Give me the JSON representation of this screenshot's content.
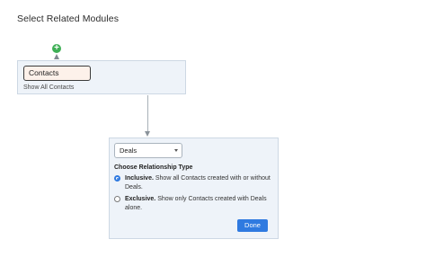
{
  "page": {
    "title": "Select Related Modules"
  },
  "add_node": {
    "symbol": "+",
    "icon": "plus-circle-icon",
    "color": "#3eaf55"
  },
  "module_card": {
    "chip_label": "Contacts",
    "subtext": "Show All Contacts"
  },
  "relation_panel": {
    "selected_module": "Deals",
    "heading": "Choose Relationship Type",
    "options": [
      {
        "title": "Inclusive.",
        "description": "Show all Contacts created with or without Deals.",
        "selected": true
      },
      {
        "title": "Exclusive.",
        "description": "Show only Contacts created with Deals alone.",
        "selected": false
      }
    ],
    "done_label": "Done"
  },
  "colors": {
    "accent": "#2f7ae0",
    "card_background": "#eef3f9",
    "chip_background": "#fdf1ea",
    "add_node": "#3eaf55"
  }
}
